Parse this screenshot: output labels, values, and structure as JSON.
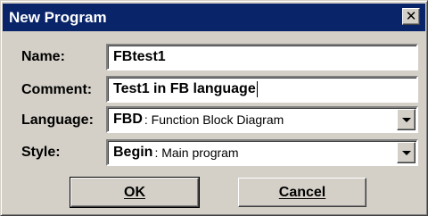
{
  "window": {
    "title": "New Program"
  },
  "titlebar": {
    "close_glyph": "✕",
    "close_icon": "close-icon"
  },
  "form": {
    "name_label": "Name:",
    "name_value": "FBtest1",
    "comment_label": "Comment:",
    "comment_value": "Test1 in FB language",
    "language_label": "Language:",
    "language_selected_code": "FBD",
    "language_selected_desc": ": Function Block Diagram",
    "style_label": "Style:",
    "style_selected_code": "Begin",
    "style_selected_desc": ": Main program"
  },
  "buttons": {
    "ok_label": "OK",
    "cancel_label": "Cancel"
  },
  "colors": {
    "titlebar": "#0a246a",
    "dialog_face": "#d4d0c8"
  }
}
